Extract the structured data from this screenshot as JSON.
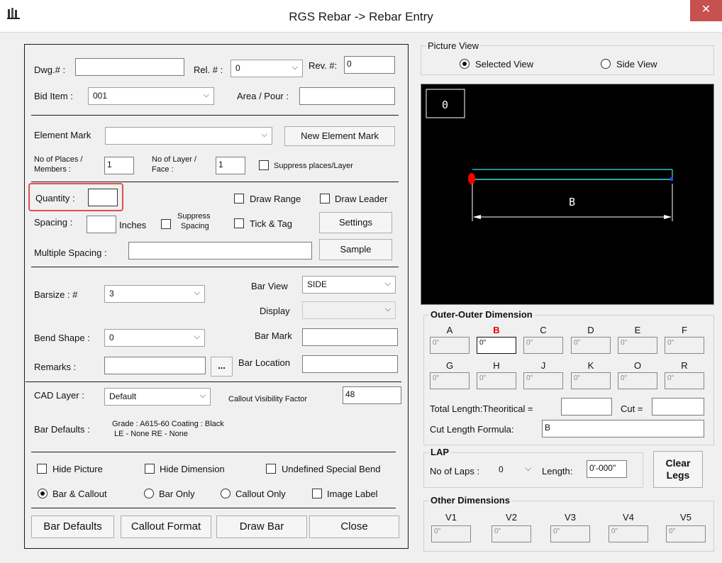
{
  "window": {
    "title": "RGS Rebar -> Rebar Entry",
    "close_glyph": "✕",
    "icon": "app-logo-icon"
  },
  "header": {
    "dwg_label": "Dwg.# :",
    "dwg_value": "",
    "rel_label": "Rel. # :",
    "rel_value": "0",
    "rev_label": "Rev. #:",
    "rev_value": "0",
    "bid_label": "Bid Item :",
    "bid_value": "001",
    "area_label": "Area / Pour :",
    "area_value": ""
  },
  "element": {
    "mark_label": "Element Mark",
    "mark_value": "",
    "new_mark_button": "New Element Mark",
    "places_label_1": "No of Places /",
    "places_label_2": "Members    :",
    "places_value": "1",
    "layer_label_1": "No of Layer /",
    "layer_label_2": "Face :",
    "layer_value": "1",
    "suppress_places_label": "Suppress places/Layer"
  },
  "quantity": {
    "quantity_label": "Quantity :",
    "quantity_value": "",
    "draw_range_label": "Draw Range",
    "draw_leader_label": "Draw Leader",
    "spacing_label": "Spacing :",
    "spacing_value": "",
    "inches_label": "Inches",
    "suppress_spacing_1": "Suppress",
    "suppress_spacing_2": "Spacing",
    "tick_tag_label": "Tick & Tag",
    "settings_button": "Settings",
    "multiple_spacing_label": "Multiple Spacing :",
    "multiple_spacing_value": "",
    "sample_button": "Sample"
  },
  "bar": {
    "barsize_label": "Barsize  : #",
    "barsize_value": "3",
    "bar_view_label": "Bar View",
    "bar_view_value": "SIDE",
    "display_label": "Display",
    "display_value": "",
    "bend_shape_label": "Bend Shape :",
    "bend_shape_value": "0",
    "bar_mark_label": "Bar Mark",
    "bar_mark_value": "",
    "remarks_label": "Remarks :",
    "remarks_value": "",
    "ellipsis_button": "...",
    "bar_location_label": "Bar Location",
    "bar_location_value": "",
    "cad_layer_label": "CAD Layer :",
    "cad_layer_value": "Default",
    "callout_factor_label": "Callout Visibility Factor",
    "callout_factor_value": "48",
    "bar_defaults_label": "Bar Defaults :",
    "bar_defaults_line1": "Grade : A615-60 Coating : Black",
    "bar_defaults_line2": "LE - None RE - None"
  },
  "options": {
    "hide_picture": "Hide Picture",
    "hide_dimension": "Hide Dimension",
    "undefined_bend": "Undefined Special Bend",
    "bar_callout": "Bar & Callout",
    "bar_only": "Bar Only",
    "callout_only": "Callout Only",
    "image_label": "Image Label"
  },
  "footer": {
    "bar_defaults_button": "Bar Defaults",
    "callout_format_button": "Callout Format",
    "draw_bar_button": "Draw Bar",
    "close_button": "Close"
  },
  "picture_view": {
    "group_title": "Picture View",
    "selected_view": "Selected View",
    "side_view": "Side View",
    "canvas_mark": "0",
    "dimension_letter": "B",
    "bar_color": "#40e0e0",
    "end_color": "#ff0000"
  },
  "outer_dimension": {
    "group_title": "Outer-Outer Dimension",
    "row1": [
      {
        "label": "A",
        "value": "0\""
      },
      {
        "label": "B",
        "value": "0\"",
        "active": true
      },
      {
        "label": "C",
        "value": "0\""
      },
      {
        "label": "D",
        "value": "0\""
      },
      {
        "label": "E",
        "value": "0\""
      },
      {
        "label": "F",
        "value": "0\""
      }
    ],
    "row2": [
      {
        "label": "G",
        "value": "0\""
      },
      {
        "label": "H",
        "value": "0\""
      },
      {
        "label": "J",
        "value": "0\""
      },
      {
        "label": "K",
        "value": "0\""
      },
      {
        "label": "O",
        "value": "0\""
      },
      {
        "label": "R",
        "value": "0\""
      }
    ],
    "total_length_label": "Total Length:Theoritical =",
    "total_length_value": "",
    "cut_label": "Cut =",
    "cut_value": "",
    "formula_label": "Cut Length Formula:",
    "formula_value": "B"
  },
  "lap": {
    "group_title": "LAP",
    "laps_label": "No of Laps :",
    "laps_value": "0",
    "length_label": "Length:",
    "length_value": "0'-000\"",
    "clear_legs_1": "Clear",
    "clear_legs_2": "Legs"
  },
  "other_dimensions": {
    "group_title": "Other Dimensions",
    "items": [
      {
        "label": "V1",
        "value": "0\""
      },
      {
        "label": "V2",
        "value": "0\""
      },
      {
        "label": "V3",
        "value": "0\""
      },
      {
        "label": "V4",
        "value": "0\""
      },
      {
        "label": "V5",
        "value": "0\""
      }
    ]
  }
}
